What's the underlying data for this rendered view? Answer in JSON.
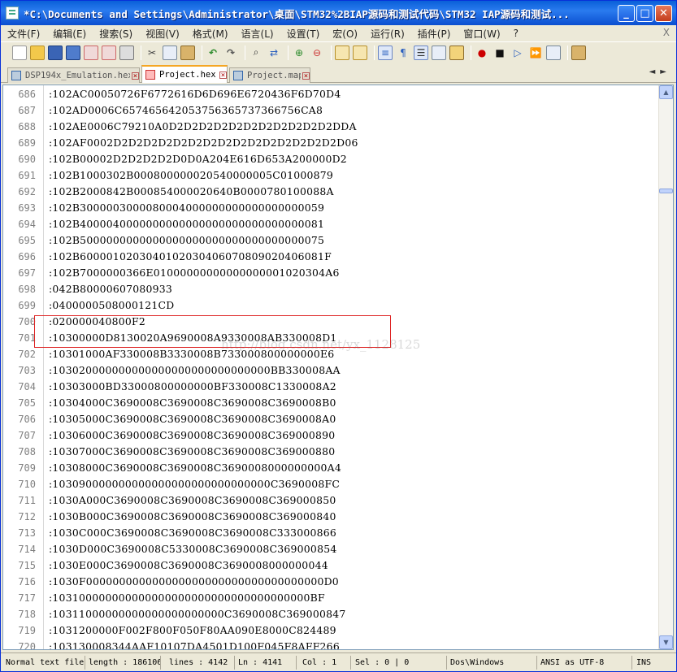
{
  "window": {
    "title": "*C:\\Documents and Settings\\Administrator\\桌面\\STM32%2BIAP源码和测试代码\\STM32 IAP源码和测试...",
    "min_label": "_",
    "max_label": "□",
    "close_label": "✕"
  },
  "menu": [
    "文件(F)",
    "编辑(E)",
    "搜索(S)",
    "视图(V)",
    "格式(M)",
    "语言(L)",
    "设置(T)",
    "宏(O)",
    "运行(R)",
    "插件(P)",
    "窗口(W)",
    "?"
  ],
  "menu_close": "X",
  "toolbar_icons": [
    "new-file-icon",
    "open-file-icon",
    "save-icon",
    "save-all-icon",
    "close-icon",
    "close-all-icon",
    "print-icon",
    "cut-icon",
    "copy-icon",
    "paste-icon",
    "undo-icon",
    "redo-icon",
    "find-icon",
    "replace-icon",
    "zoom-in-icon",
    "zoom-out-icon",
    "sync-v-icon",
    "sync-h-icon",
    "word-wrap-icon",
    "show-all-chars-icon",
    "indent-guide-icon",
    "doc-map-icon",
    "function-list-icon",
    "record-macro-icon",
    "stop-record-icon",
    "play-macro-icon",
    "run-macro-multiple-icon",
    "save-macro-icon",
    "spell-check-icon"
  ],
  "tabs": [
    {
      "label": "DSP194x_Emulation.hex",
      "active": false
    },
    {
      "label": "Project.hex",
      "active": true
    },
    {
      "label": "Project.map",
      "active": false
    }
  ],
  "tab_nav": "◄►",
  "editor": {
    "lines": [
      {
        "n": "686",
        "text": ":102AC00050726F6772616D6D696E6720436F6D70D4"
      },
      {
        "n": "687",
        "text": ":102AD0006C657465642053756365737366756CA8"
      },
      {
        "n": "688",
        "text": ":102AE0006C79210A0D2D2D2D2D2D2D2D2D2D2D2DDA"
      },
      {
        "n": "689",
        "text": ":102AF0002D2D2D2D2D2D2D2D2D2D2D2D2D2D2D2D06"
      },
      {
        "n": "690",
        "text": ":102B00002D2D2D2D2D0D0A204E616D653A200000D2"
      },
      {
        "n": "691",
        "text": ":102B1000302B000800000020540000005C01000879"
      },
      {
        "n": "692",
        "text": ":102B2000842B000854000020640B0000780100088A"
      },
      {
        "n": "693",
        "text": ":102B3000003000080004000000000000000000059"
      },
      {
        "n": "694",
        "text": ":102B4000040000000000000000000000000000081"
      },
      {
        "n": "695",
        "text": ":102B5000000000000000000000000000000000075"
      },
      {
        "n": "696",
        "text": ":102B6000010203040102030406070809020406081F"
      },
      {
        "n": "697",
        "text": ":102B7000000366E01000000000000000001020304A6"
      },
      {
        "n": "698",
        "text": ":042B80000607080933"
      },
      {
        "n": "699",
        "text": ":0400000508000121CD"
      },
      {
        "n": "700",
        "text": ":020000040800F2"
      },
      {
        "n": "701",
        "text": ":10300000D8130020A9690008A9330008AB330008D1"
      },
      {
        "n": "702",
        "text": ":10301000AF330008B3330008B733000800000000E6"
      },
      {
        "n": "703",
        "text": ":103020000000000000000000000000000BB330008AA"
      },
      {
        "n": "704",
        "text": ":10303000BD33000800000000BF330008C1330008A2"
      },
      {
        "n": "705",
        "text": ":10304000C3690008C3690008C3690008C3690008B0"
      },
      {
        "n": "706",
        "text": ":10305000C3690008C3690008C3690008C3690008A0"
      },
      {
        "n": "707",
        "text": ":10306000C3690008C3690008C3690008C369000890"
      },
      {
        "n": "708",
        "text": ":10307000C3690008C3690008C3690008C369000880"
      },
      {
        "n": "709",
        "text": ":10308000C3690008C3690008C3690008000000000A4"
      },
      {
        "n": "710",
        "text": ":103090000000000000000000000000000C3690008FC"
      },
      {
        "n": "711",
        "text": ":1030A000C3690008C3690008C3690008C369000850"
      },
      {
        "n": "712",
        "text": ":1030B000C3690008C3690008C3690008C369000840"
      },
      {
        "n": "713",
        "text": ":1030C000C3690008C3690008C3690008C333000866"
      },
      {
        "n": "714",
        "text": ":1030D000C3690008C5330008C3690008C369000854"
      },
      {
        "n": "715",
        "text": ":1030E000C3690008C3690008C3690008000000044"
      },
      {
        "n": "716",
        "text": ":1030F000000000000000000000000000000000000D0"
      },
      {
        "n": "717",
        "text": ":103100000000000000000000000000000000000BF"
      },
      {
        "n": "718",
        "text": ":10311000000000000000000000C3690008C369000847"
      },
      {
        "n": "719",
        "text": ":1031200000F002F800F050F80AA090E8000C824489"
      },
      {
        "n": "720",
        "text": ":103130008344AAF10107DA4501D100F045F8AFF266"
      }
    ],
    "watermark": "http://blog.csdn.net/yx_1128125"
  },
  "status": {
    "type": "Normal text file",
    "length": "length : 186106",
    "lines": "lines : 4142",
    "ln": "Ln : 4141",
    "col": "Col : 1",
    "sel": "Sel : 0 | 0",
    "eol": "Dos\\Windows",
    "encoding": "ANSI as UTF-8",
    "mode": "INS"
  },
  "colors": {
    "titlebar": "#0a5fd8",
    "highlight_box": "#dd2222",
    "line_number": "#808080"
  }
}
